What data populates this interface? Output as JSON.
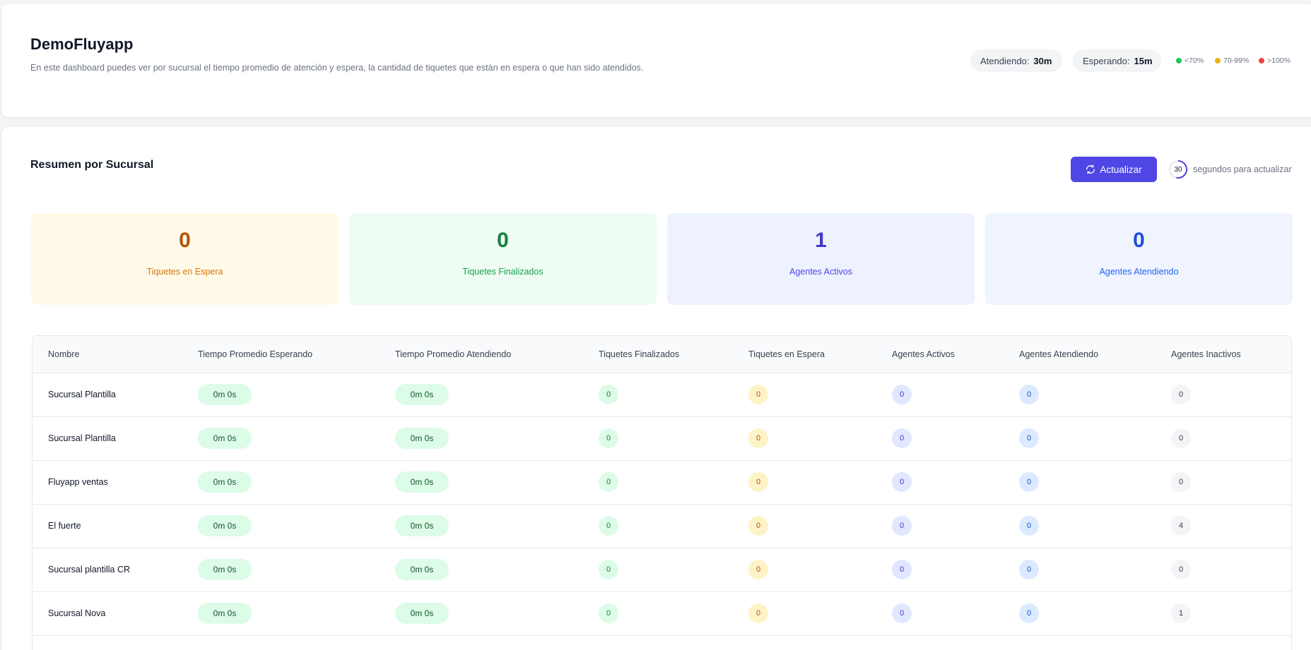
{
  "header": {
    "title": "DemoFluyapp",
    "description": "En este dashboard puedes ver por sucursal el tiempo promedio de atención y espera, la cantidad de tiquetes que están en espera o que han sido atendidos.",
    "attending_label": "Atendiendo:",
    "attending_value": "30m",
    "waiting_label": "Esperando:",
    "waiting_value": "15m",
    "legend": [
      {
        "label": "<70%",
        "color": "#22c55e"
      },
      {
        "label": "70-99%",
        "color": "#eab308"
      },
      {
        "label": ">100%",
        "color": "#ef4444"
      }
    ]
  },
  "summary": {
    "title": "Resumen por Sucursal",
    "refresh_label": "Actualizar",
    "countdown_value": "30",
    "countdown_label": "segundos para actualizar"
  },
  "stats": [
    {
      "value": "0",
      "label": "Tiquetes en Espera"
    },
    {
      "value": "0",
      "label": "Tiquetes Finalizados"
    },
    {
      "value": "1",
      "label": "Agentes Activos"
    },
    {
      "value": "0",
      "label": "Agentes Atendiendo"
    }
  ],
  "table": {
    "columns": [
      "Nombre",
      "Tiempo Promedio Esperando",
      "Tiempo Promedio Atendiendo",
      "Tiquetes Finalizados",
      "Tiquetes en Espera",
      "Agentes Activos",
      "Agentes Atendiendo",
      "Agentes Inactivos"
    ],
    "rows": [
      {
        "name": "Sucursal Plantilla",
        "wait": "0m 0s",
        "attend": "0m 0s",
        "finished": "0",
        "waiting": "0",
        "active": "0",
        "attending": "0",
        "inactive": "0"
      },
      {
        "name": "Sucursal Plantilla",
        "wait": "0m 0s",
        "attend": "0m 0s",
        "finished": "0",
        "waiting": "0",
        "active": "0",
        "attending": "0",
        "inactive": "0"
      },
      {
        "name": "Fluyapp ventas",
        "wait": "0m 0s",
        "attend": "0m 0s",
        "finished": "0",
        "waiting": "0",
        "active": "0",
        "attending": "0",
        "inactive": "0"
      },
      {
        "name": "El fuerte",
        "wait": "0m 0s",
        "attend": "0m 0s",
        "finished": "0",
        "waiting": "0",
        "active": "0",
        "attending": "0",
        "inactive": "4"
      },
      {
        "name": "Sucursal plantilla CR",
        "wait": "0m 0s",
        "attend": "0m 0s",
        "finished": "0",
        "waiting": "0",
        "active": "0",
        "attending": "0",
        "inactive": "0"
      },
      {
        "name": "Sucursal Nova",
        "wait": "0m 0s",
        "attend": "0m 0s",
        "finished": "0",
        "waiting": "0",
        "active": "0",
        "attending": "0",
        "inactive": "1"
      }
    ]
  }
}
